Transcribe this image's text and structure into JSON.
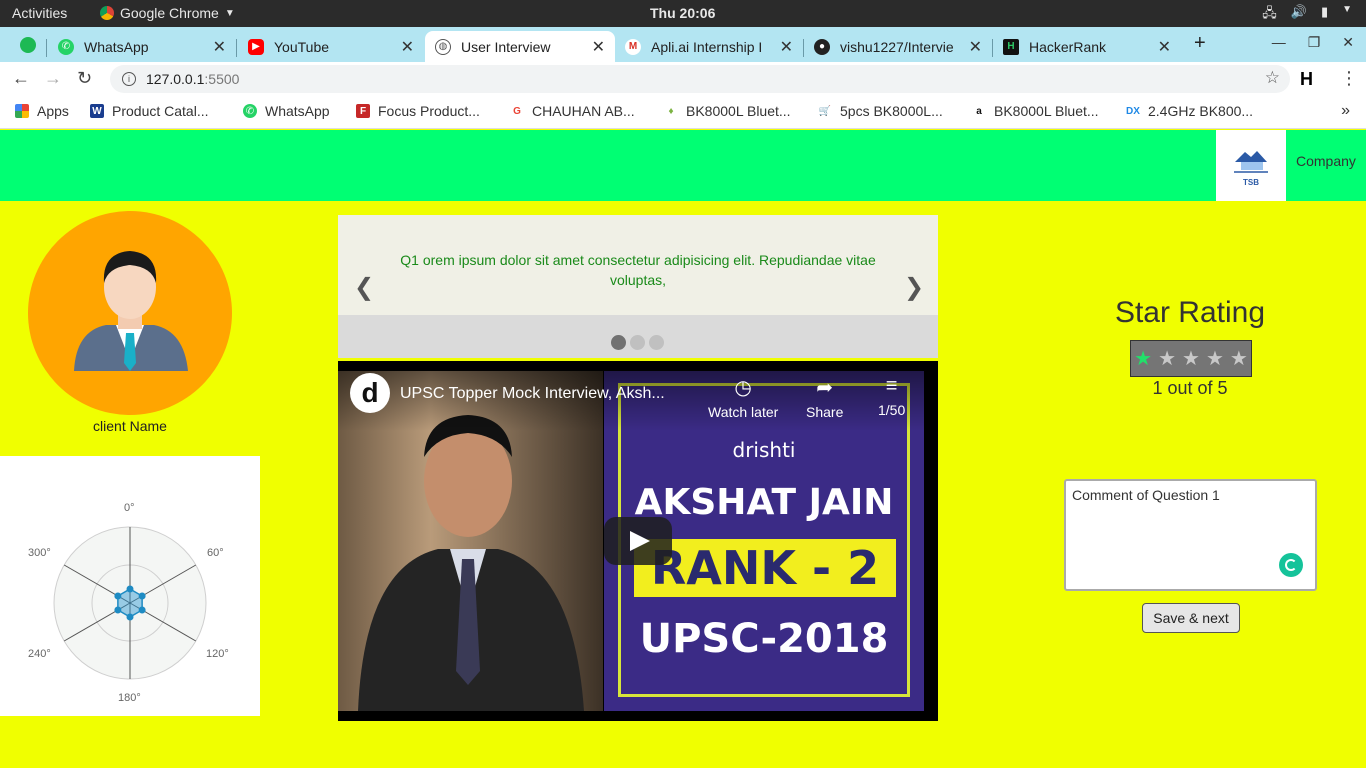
{
  "system_bar": {
    "activities": "Activities",
    "app_name": "Google Chrome",
    "clock": "Thu 20:06"
  },
  "browser": {
    "tabs": [
      {
        "title": "WhatsApp",
        "icon": "whatsapp-icon",
        "active": false
      },
      {
        "title": "YouTube",
        "icon": "youtube-icon",
        "active": false
      },
      {
        "title": "User Interview",
        "icon": "globe-icon",
        "active": true
      },
      {
        "title": "Apli.ai Internship I",
        "icon": "gmail-icon",
        "active": false
      },
      {
        "title": "vishu1227/Intervie",
        "icon": "github-icon",
        "active": false
      },
      {
        "title": "HackerRank",
        "icon": "hackerrank-icon",
        "active": false
      }
    ],
    "url_host": "127.0.0.1",
    "url_port": ":5500",
    "bookmarks": [
      {
        "label": "Apps",
        "icon": "apps-grid-icon"
      },
      {
        "label": "Product Catal...",
        "icon": "w-icon"
      },
      {
        "label": "WhatsApp",
        "icon": "whatsapp-icon"
      },
      {
        "label": "Focus Product...",
        "icon": "focus-icon"
      },
      {
        "label": "CHAUHAN AB...",
        "icon": "google-icon"
      },
      {
        "label": "BK8000L Bluet...",
        "icon": "bulb-icon"
      },
      {
        "label": "5pcs BK8000L...",
        "icon": "cart-icon"
      },
      {
        "label": "BK8000L Bluet...",
        "icon": "amazon-icon"
      },
      {
        "label": "2.4GHz BK800...",
        "icon": "dx-icon"
      }
    ]
  },
  "page": {
    "header": {
      "logo_text": "TSB",
      "company_link": "Company"
    },
    "client": {
      "name": "client Name"
    },
    "radar": {
      "angle_labels": [
        "0°",
        "60°",
        "120°",
        "180°",
        "240°",
        "300°"
      ]
    },
    "carousel": {
      "question_text": "Q1 orem ipsum dolor sit amet consectetur adipisicing elit. Repudiandae vitae voluptas,",
      "prev_arrow": "❮",
      "next_arrow": "❯",
      "slide_count": 3,
      "active_slide": 1
    },
    "video": {
      "title": "UPSC Topper Mock Interview, Aksh...",
      "watch_later": "Watch later",
      "share": "Share",
      "playlist_position": "1/50",
      "thumb_brand": "drishti",
      "thumb_name": "AKSHAT JAIN",
      "thumb_rank": "RANK - 2",
      "thumb_exam": "UPSC-2018"
    },
    "rating": {
      "title": "Star Rating",
      "value": 1,
      "max": 5,
      "summary": "1 out of 5",
      "active_color": "#21e06a"
    },
    "comment": {
      "value": "Comment of Question 1"
    },
    "save_button": "Save & next"
  }
}
